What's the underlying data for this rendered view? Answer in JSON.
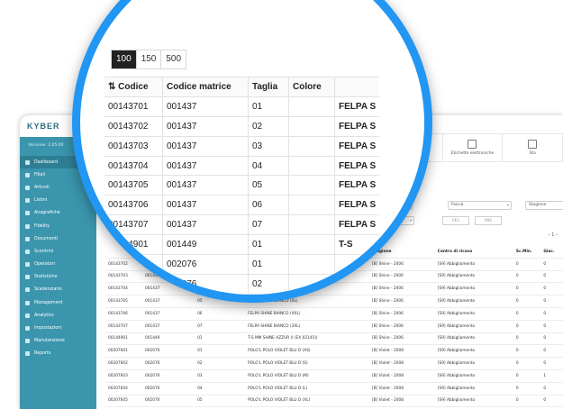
{
  "app": {
    "logo": "KYBER",
    "version": "Versione: 2.05.00"
  },
  "sidebar": {
    "items": [
      {
        "label": "Dashboard"
      },
      {
        "label": "Filiali"
      },
      {
        "label": "Articoli"
      },
      {
        "label": "Listini"
      },
      {
        "label": "Anagrafiche"
      },
      {
        "label": "Fidelity"
      },
      {
        "label": "Documenti"
      },
      {
        "label": "Scontrini"
      },
      {
        "label": "Operatori"
      },
      {
        "label": "Statistiche"
      },
      {
        "label": "Scadenziario"
      },
      {
        "label": "Management"
      },
      {
        "label": "Analytics"
      },
      {
        "label": "Impostazioni"
      },
      {
        "label": "Manutenzione"
      },
      {
        "label": "Reports"
      }
    ]
  },
  "toolbar": {
    "buttons": [
      {
        "label": "Export articoli"
      },
      {
        "label": "Export articoli"
      },
      {
        "label": "Etichette elettroniche"
      },
      {
        "label": "Sta"
      }
    ]
  },
  "filters": {
    "marchio": "chio",
    "fascia": "Fascia",
    "stagione": "Stagione",
    "tipo": "po",
    "tasto": "Tasto",
    "prev": "PEV",
    "pba": "PBA",
    "page": "1"
  },
  "background_table": {
    "headers": [
      "",
      "",
      "",
      "",
      "Stagione",
      "Centro di ricavo",
      "Sc.Min.",
      "Giac."
    ],
    "rows": [
      [
        "00143702",
        "001437",
        "02",
        "FELPA SHINE BIANCO (S)",
        "[B] Shine - 2006",
        "[S9] Abbigliamento",
        "0",
        "0"
      ],
      [
        "00143703",
        "001437",
        "03",
        "FELPA SHINE BIANCO (M)",
        "[B] Shine - 2006",
        "[S9] Abbigliamento",
        "0",
        "0"
      ],
      [
        "00143704",
        "001437",
        "04",
        "FELPA SHINE BIANCO (L)",
        "[B] Shine - 2006",
        "[S9] Abbigliamento",
        "0",
        "0"
      ],
      [
        "00143705",
        "001437",
        "05",
        "FELPA SHINE BIANCO (XL)",
        "[B] Shine - 2006",
        "[S9] Abbigliamento",
        "0",
        "0"
      ],
      [
        "00143706",
        "001437",
        "06",
        "FELPA SHINE BIANCO (XXL)",
        "[B] Shine - 2006",
        "[S9] Abbigliamento",
        "0",
        "0"
      ],
      [
        "00143707",
        "001437",
        "07",
        "FELPA SHINE BIANCO (3XL)",
        "[B] Shine - 2006",
        "[S9] Abbigliamento",
        "0",
        "0"
      ],
      [
        "00144901",
        "001449",
        "01",
        "T-S MM SHINE AZZUR (I (EX 02145))",
        "[B] Shine - 2006",
        "[S9] Abbigliamento",
        "0",
        "0"
      ],
      [
        "00207601",
        "002076",
        "01",
        "POLO'L POLO VIOLET BLU D (XS)",
        "[B] Violet - 2008",
        "[S9] Abbigliamento",
        "0",
        "0"
      ],
      [
        "00207602",
        "002076",
        "02",
        "POLO'L POLO VIOLET BLU D (S)",
        "[B] Violet - 2008",
        "[S9] Abbigliamento",
        "0",
        "0"
      ],
      [
        "00207603",
        "002076",
        "03",
        "POLO'L POLO VIOLET BLU D (M)",
        "[B] Violet - 2008",
        "[S9] Abbigliamento",
        "0",
        "1"
      ],
      [
        "00207604",
        "002076",
        "04",
        "POLO'L POLO VIOLET BLU D (L)",
        "[B] Violet - 2008",
        "[S9] Abbigliamento",
        "0",
        "0"
      ],
      [
        "00207605",
        "002076",
        "05",
        "POLO'L POLO VIOLET BLU D (XL)",
        "[B] Violet - 2008",
        "[S9] Abbigliamento",
        "0",
        "0"
      ]
    ]
  },
  "zoom": {
    "page_sizes": [
      "100",
      "150",
      "500"
    ],
    "headers": [
      "Codice",
      "Codice matrice",
      "Taglia",
      "Colore",
      ""
    ],
    "rows": [
      [
        "00143701",
        "001437",
        "01",
        "",
        "FELPA S"
      ],
      [
        "00143702",
        "001437",
        "02",
        "",
        "FELPA S"
      ],
      [
        "00143703",
        "001437",
        "03",
        "",
        "FELPA S"
      ],
      [
        "00143704",
        "001437",
        "04",
        "",
        "FELPA S"
      ],
      [
        "00143705",
        "001437",
        "05",
        "",
        "FELPA S"
      ],
      [
        "00143706",
        "001437",
        "06",
        "",
        "FELPA S"
      ],
      [
        "00143707",
        "001437",
        "07",
        "",
        "FELPA S"
      ],
      [
        "00144901",
        "001449",
        "01",
        "",
        "T-S"
      ],
      [
        "00207601",
        "002076",
        "01",
        "",
        ""
      ],
      [
        "00207602",
        "002076",
        "02",
        "",
        ""
      ],
      [
        "",
        "002076",
        "03",
        "",
        ""
      ]
    ]
  },
  "colors": {
    "accent": "#2196f3",
    "sidebar": "#3a95ad"
  }
}
